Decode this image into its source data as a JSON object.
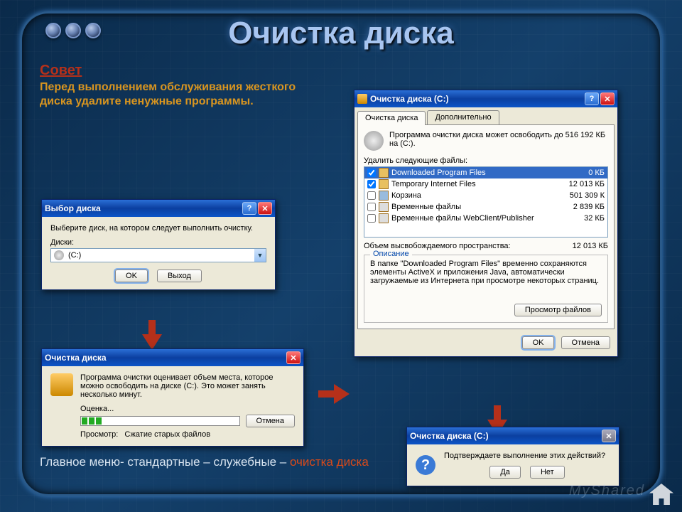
{
  "slide": {
    "title": "Очистка диска"
  },
  "advice": {
    "heading": "Совет",
    "body": "Перед выполнением обслуживания жесткого диска удалите ненужные программы."
  },
  "dlg1": {
    "title": "Выбор диска",
    "instruction": "Выберите диск, на котором следует выполнить очистку.",
    "drives_label": "Диски:",
    "selected_drive": "(C:)",
    "ok": "OK",
    "exit": "Выход"
  },
  "dlg2": {
    "title": "Очистка диска",
    "message": "Программа очистки оценивает объем места, которое можно освободить на диске (C:). Это может занять несколько минут.",
    "estimate_label": "Оценка...",
    "cancel": "Отмена",
    "scan_label": "Просмотр:",
    "scan_value": "Сжатие старых файлов"
  },
  "dlg3": {
    "title": "Очистка диска (C:)",
    "tabs": [
      "Очистка диска",
      "Дополнительно"
    ],
    "summary": "Программа очистки диска может освободить до 516 192 КБ на (C:).",
    "delete_label": "Удалить следующие файлы:",
    "files": [
      {
        "name": "Downloaded Program Files",
        "size": "0 КБ",
        "checked": true
      },
      {
        "name": "Temporary Internet Files",
        "size": "12 013 КБ",
        "checked": true
      },
      {
        "name": "Корзина",
        "size": "501 309 К",
        "checked": false
      },
      {
        "name": "Временные файлы",
        "size": "2 839 КБ",
        "checked": false
      },
      {
        "name": "Временные файлы WebClient/Publisher",
        "size": "32 КБ",
        "checked": false
      }
    ],
    "freespace_label": "Объем высвобождаемого пространства:",
    "freespace_value": "12 013 КБ",
    "desc_legend": "Описание",
    "description": "В папке \"Downloaded Program Files\" временно сохраняются элементы ActiveX и приложения Java, автоматически загружаемые из Интернета при просмотре некоторых страниц.",
    "view_files": "Просмотр файлов",
    "ok": "OK",
    "cancel": "Отмена"
  },
  "dlg4": {
    "title": "Очистка диска (C:)",
    "message": "Подтверждаете выполнение этих действий?",
    "yes": "Да",
    "no": "Нет"
  },
  "path": {
    "a": "Главное меню- стандартные – служебные – ",
    "b": "очистка диска"
  },
  "watermark": "MyShared"
}
